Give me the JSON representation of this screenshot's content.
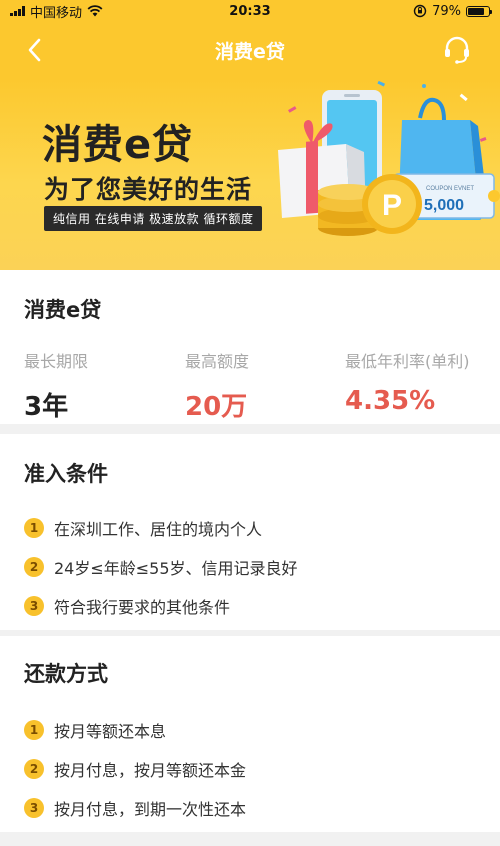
{
  "status_bar": {
    "carrier": "中国移动",
    "time": "20:33",
    "battery": "79%",
    "battery_level": 0.79
  },
  "nav": {
    "title": "消费e贷"
  },
  "banner": {
    "title": "消费e贷",
    "subtitle": "为了您美好的生活",
    "tags": "纯信用 在线申请 极速放款 循环额度",
    "coupon_caption": "COUPON EVNET",
    "coupon_value": "5,000",
    "coin_letter": "P"
  },
  "product": {
    "title": "消费e贷",
    "stats": [
      {
        "label": "最长期限",
        "value": "3年"
      },
      {
        "label": "最高额度",
        "value": "20万"
      },
      {
        "label": "最低年利率(单利)",
        "value": "4.35%"
      }
    ]
  },
  "conditions": {
    "title": "准入条件",
    "items": [
      {
        "num": "1",
        "text": "在深圳工作、居住的境内个人"
      },
      {
        "num": "2",
        "text": "24岁≤年龄≤55岁、信用记录良好"
      },
      {
        "num": "3",
        "text": "符合我行要求的其他条件"
      }
    ]
  },
  "repayment": {
    "title": "还款方式",
    "items": [
      {
        "num": "1",
        "text": "按月等额还本息"
      },
      {
        "num": "2",
        "text": "按月付息，按月等额还本金"
      },
      {
        "num": "3",
        "text": "按月付息，到期一次性还本"
      }
    ]
  },
  "colors": {
    "brand_yellow": "#fcc82e",
    "value_red": "#e55b4f",
    "badge_yellow": "#f8c12c"
  }
}
